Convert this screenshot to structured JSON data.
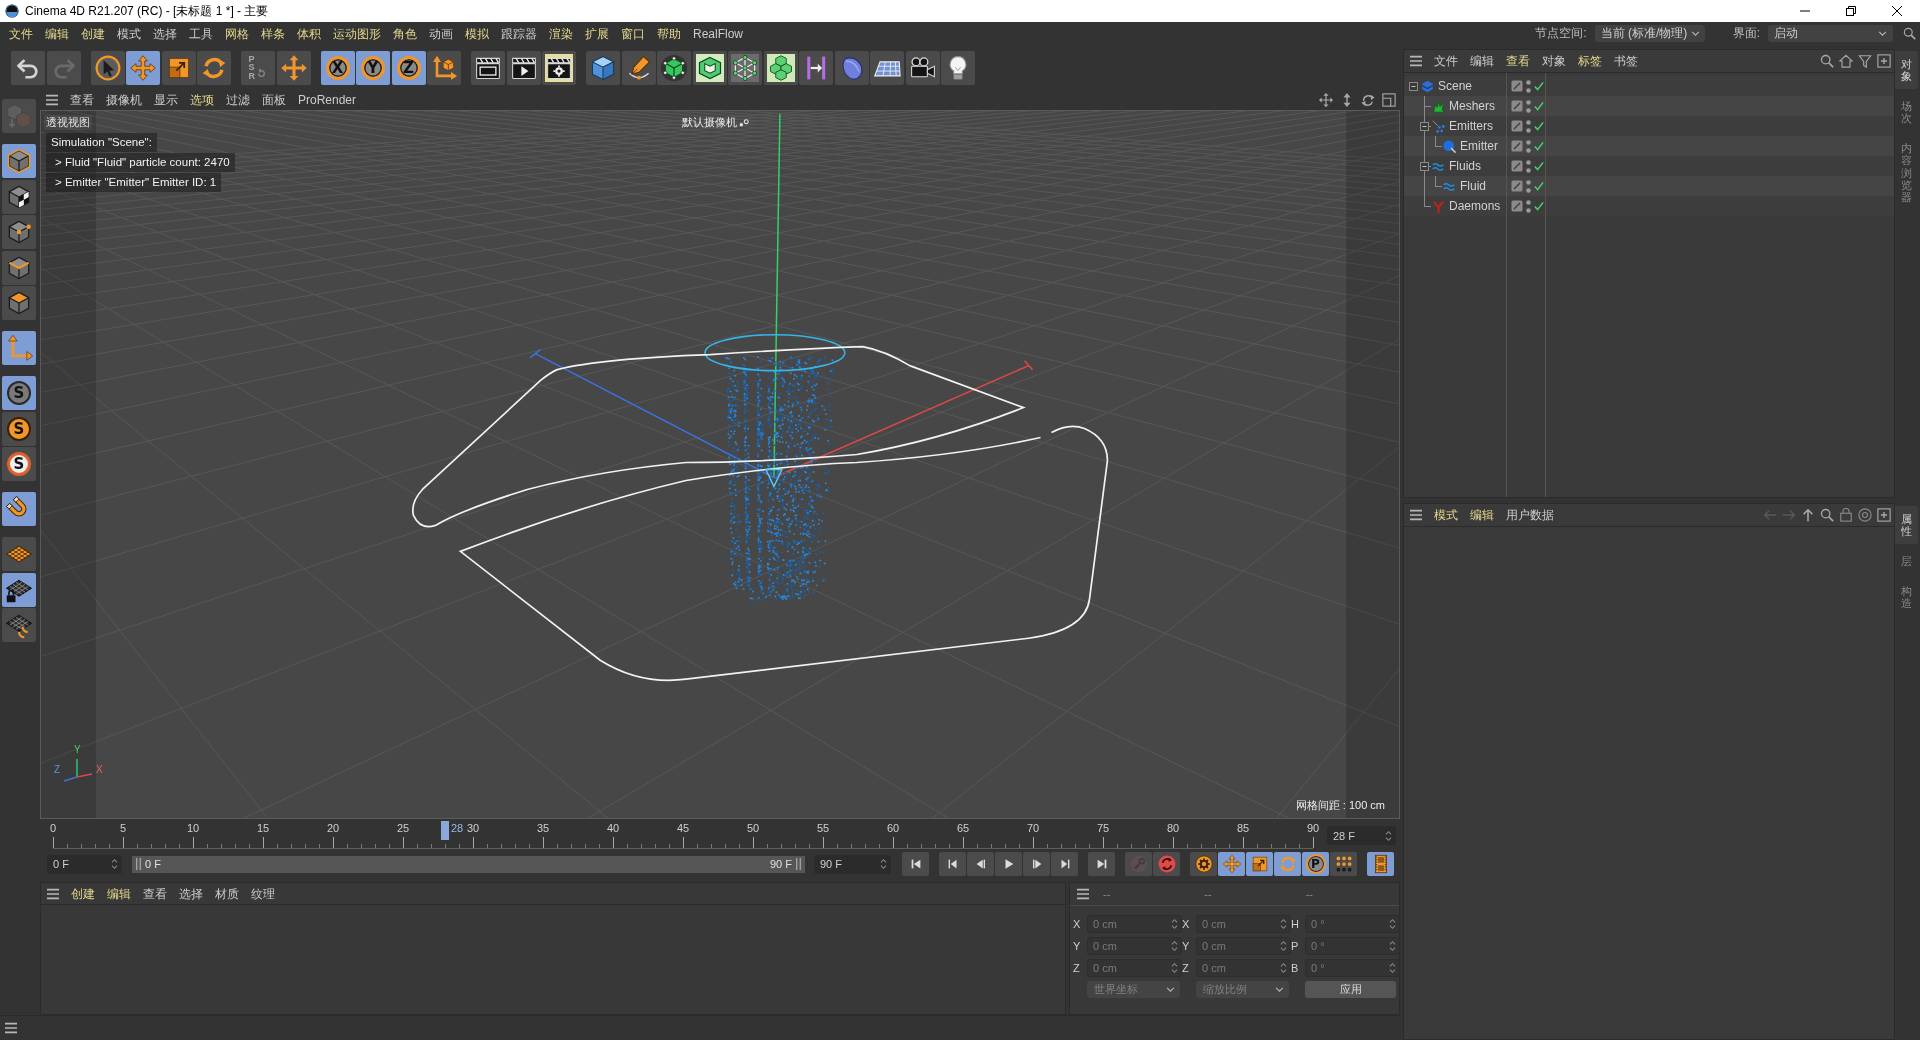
{
  "window": {
    "title": "Cinema 4D R21.207 (RC) - [未标题 1 *] - 主要"
  },
  "menu": [
    {
      "label": "文件",
      "highlighted": true
    },
    {
      "label": "编辑",
      "highlighted": true
    },
    {
      "label": "创建",
      "highlighted": true
    },
    {
      "label": "模式",
      "highlighted": false
    },
    {
      "label": "选择",
      "highlighted": false
    },
    {
      "label": "工具",
      "highlighted": false
    },
    {
      "label": "网格",
      "highlighted": true
    },
    {
      "label": "样条",
      "highlighted": true
    },
    {
      "label": "体积",
      "highlighted": true
    },
    {
      "label": "运动图形",
      "highlighted": true
    },
    {
      "label": "角色",
      "highlighted": true
    },
    {
      "label": "动画",
      "highlighted": false
    },
    {
      "label": "模拟",
      "highlighted": true
    },
    {
      "label": "跟踪器",
      "highlighted": false
    },
    {
      "label": "渲染",
      "highlighted": true
    },
    {
      "label": "扩展",
      "highlighted": true
    },
    {
      "label": "窗口",
      "highlighted": true
    },
    {
      "label": "帮助",
      "highlighted": true
    },
    {
      "label": "RealFlow",
      "highlighted": false
    }
  ],
  "node_space": {
    "label": "节点空间:",
    "value": "当前 (标准/物理)"
  },
  "layout_picker": {
    "label": "界面:",
    "value": "启动"
  },
  "toolbar": [
    [
      {
        "kind": "undo",
        "active": false,
        "disabled": false
      },
      {
        "kind": "redo",
        "active": false,
        "disabled": true
      }
    ],
    [
      {
        "kind": "select",
        "active": false,
        "disabled": false
      },
      {
        "kind": "move",
        "active": true,
        "disabled": false
      },
      {
        "kind": "scale",
        "active": false,
        "disabled": false
      },
      {
        "kind": "rotate",
        "active": false,
        "disabled": false
      }
    ],
    [
      {
        "kind": "psr",
        "label": "PSR",
        "active": false,
        "disabled": true
      },
      {
        "kind": "add",
        "active": false,
        "disabled": false
      }
    ],
    [
      {
        "kind": "axis",
        "label": "X",
        "active": true,
        "disabled": false
      },
      {
        "kind": "axis",
        "label": "Y",
        "active": true,
        "disabled": false
      },
      {
        "kind": "axis",
        "label": "Z",
        "active": true,
        "disabled": false
      },
      {
        "kind": "coords",
        "active": false,
        "disabled": false
      }
    ],
    [
      {
        "kind": "renderview",
        "active": false,
        "disabled": false
      },
      {
        "kind": "render",
        "active": false,
        "disabled": false
      },
      {
        "kind": "rendersettings",
        "active": false,
        "disabled": false
      }
    ],
    [
      {
        "kind": "cube",
        "active": false,
        "disabled": false
      },
      {
        "kind": "pen",
        "active": false,
        "disabled": false
      },
      {
        "kind": "subdivide",
        "active": false,
        "disabled": false
      },
      {
        "kind": "extrude",
        "active": false,
        "disabled": false
      },
      {
        "kind": "array",
        "active": false,
        "disabled": false
      },
      {
        "kind": "cloner",
        "active": false,
        "disabled": false
      },
      {
        "kind": "deformer",
        "active": false,
        "disabled": false
      },
      {
        "kind": "field",
        "active": false,
        "disabled": false
      },
      {
        "kind": "floor",
        "active": false,
        "disabled": false
      },
      {
        "kind": "camera",
        "active": false,
        "disabled": false
      },
      {
        "kind": "light",
        "active": false,
        "disabled": false
      }
    ]
  ],
  "left_tools": [
    [
      {
        "kind": "editable",
        "active": false,
        "disabled": true
      }
    ],
    [
      {
        "kind": "model",
        "active": true,
        "disabled": false
      },
      {
        "kind": "texture",
        "active": false,
        "disabled": false
      },
      {
        "kind": "points",
        "active": false,
        "disabled": false
      },
      {
        "kind": "edges",
        "active": false,
        "disabled": false
      },
      {
        "kind": "polygons",
        "active": false,
        "disabled": false
      }
    ],
    [
      {
        "kind": "axis",
        "active": true,
        "disabled": false
      }
    ],
    [
      {
        "kind": "solo",
        "label": "S",
        "active": true,
        "disabled": false
      },
      {
        "kind": "sologroup",
        "label": "S",
        "active": false,
        "disabled": false
      },
      {
        "kind": "soloring",
        "label": "S",
        "active": false,
        "disabled": false
      }
    ],
    [
      {
        "kind": "snap",
        "active": true,
        "disabled": false
      }
    ],
    [
      {
        "kind": "workplane",
        "active": false,
        "disabled": false
      },
      {
        "kind": "planelock",
        "active": true,
        "disabled": false
      },
      {
        "kind": "planealign",
        "active": false,
        "disabled": false
      }
    ]
  ],
  "viewport": {
    "menu": [
      {
        "label": "查看",
        "highlighted": false
      },
      {
        "label": "摄像机",
        "highlighted": false
      },
      {
        "label": "显示",
        "highlighted": false
      },
      {
        "label": "选项",
        "highlighted": true
      },
      {
        "label": "过滤",
        "highlighted": false
      },
      {
        "label": "面板",
        "highlighted": false
      },
      {
        "label": "ProRender",
        "highlighted": false
      }
    ],
    "view_name": "透视视图",
    "camera": "默认摄像机",
    "hud": [
      "Simulation \"Scene\":",
      "> Fluid \"Fluid\" particle count: 2470",
      "> Emitter \"Emitter\" Emitter ID: 1"
    ],
    "grid_spacing": "网格间距 : 100 cm",
    "gizmo": {
      "y": "Y",
      "z": "Z",
      "x": "X"
    }
  },
  "timeline": {
    "ticks": [
      "0",
      "5",
      "10",
      "15",
      "20",
      "25",
      "30",
      "35",
      "40",
      "45",
      "50",
      "55",
      "60",
      "65",
      "70",
      "75",
      "80",
      "85",
      "90"
    ],
    "playhead": {
      "label": "28",
      "level": 0.3111
    },
    "current_frame": "28 F",
    "start_frame": "0 F",
    "range_start": "0 F",
    "range_end": "90 F",
    "end_frame": "90 F",
    "key_tools": [
      [
        {
          "kind": "record",
          "active": false,
          "disabled": true
        },
        {
          "kind": "autokey",
          "active": false,
          "disabled": false
        }
      ],
      [
        {
          "kind": "keyset",
          "active": false,
          "disabled": false
        },
        {
          "kind": "position",
          "active": true,
          "disabled": false
        },
        {
          "kind": "scale",
          "active": true,
          "disabled": false
        },
        {
          "kind": "rotation",
          "active": true,
          "disabled": false
        },
        {
          "kind": "parameter",
          "label": "P",
          "active": true,
          "disabled": false
        },
        {
          "kind": "pointlevel",
          "active": false,
          "disabled": false
        }
      ],
      [
        {
          "kind": "timeline",
          "active": true,
          "disabled": false
        }
      ]
    ]
  },
  "material_manager": {
    "menu": [
      {
        "label": "创建",
        "highlighted": true
      },
      {
        "label": "编辑",
        "highlighted": true
      },
      {
        "label": "查看",
        "highlighted": false
      },
      {
        "label": "选择",
        "highlighted": false
      },
      {
        "label": "材质",
        "highlighted": false
      },
      {
        "label": "纹理",
        "highlighted": false
      }
    ]
  },
  "coordinates": {
    "disabled": true,
    "headers": [
      "--",
      "--",
      "--"
    ],
    "rows": [
      [
        {
          "axis": "X",
          "value": "0 cm"
        },
        {
          "axis": "X",
          "value": "0 cm"
        },
        {
          "axis": "H",
          "value": "0 °"
        }
      ],
      [
        {
          "axis": "Y",
          "value": "0 cm"
        },
        {
          "axis": "Y",
          "value": "0 cm"
        },
        {
          "axis": "P",
          "value": "0 °"
        }
      ],
      [
        {
          "axis": "Z",
          "value": "0 cm"
        },
        {
          "axis": "Z",
          "value": "0 cm"
        },
        {
          "axis": "B",
          "value": "0 °"
        }
      ]
    ],
    "mode": "世界坐标",
    "scale_mode": "缩放比例",
    "apply": "应用"
  },
  "object_manager": {
    "menu": [
      {
        "label": "文件",
        "highlighted": false
      },
      {
        "label": "编辑",
        "highlighted": false
      },
      {
        "label": "查看",
        "highlighted": true
      },
      {
        "label": "对象",
        "highlighted": false
      },
      {
        "label": "标签",
        "highlighted": true
      },
      {
        "label": "书签",
        "highlighted": false
      }
    ],
    "tree": [
      {
        "name": "Scene",
        "kind": "scene",
        "expanded": true,
        "enabled": true,
        "children": [
          {
            "name": "Meshers",
            "kind": "mesher",
            "enabled": true
          },
          {
            "name": "Emitters",
            "kind": "emitters",
            "expanded": true,
            "enabled": true,
            "children": [
              {
                "name": "Emitter",
                "kind": "emitter",
                "enabled": true
              }
            ]
          },
          {
            "name": "Fluids",
            "kind": "fluids",
            "expanded": true,
            "enabled": true,
            "children": [
              {
                "name": "Fluid",
                "kind": "fluid",
                "enabled": true
              }
            ]
          },
          {
            "name": "Daemons",
            "kind": "daemons",
            "enabled": true
          }
        ]
      }
    ]
  },
  "attribute_manager": {
    "menu": [
      {
        "label": "模式",
        "highlighted": true
      },
      {
        "label": "编辑",
        "highlighted": true
      },
      {
        "label": "用户数据",
        "highlighted": false
      }
    ]
  },
  "side_tabs": {
    "top": [
      {
        "label": "对象",
        "selected": true
      },
      {
        "label": "场次",
        "selected": false
      },
      {
        "label": "内容浏览器",
        "selected": false
      }
    ],
    "bottom": [
      {
        "label": "属性",
        "selected": true
      },
      {
        "label": "层",
        "selected": false
      },
      {
        "label": "构造",
        "selected": false
      }
    ]
  }
}
